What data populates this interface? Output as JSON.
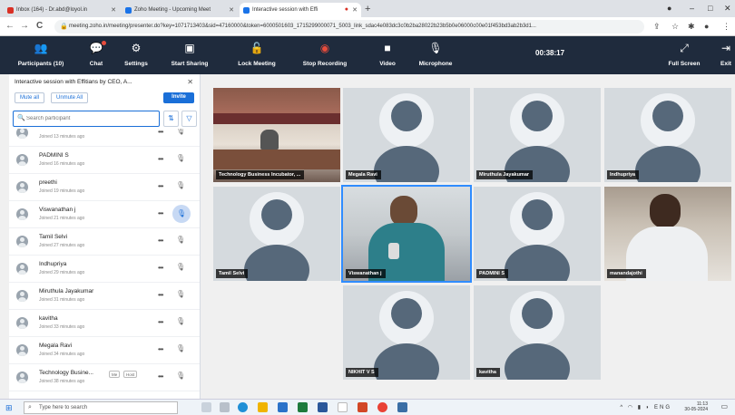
{
  "browser": {
    "tabs": [
      {
        "label": "Inbox (164) - Dr.abd@loyol.in",
        "color": "#d93025"
      },
      {
        "label": "Zoho Meeting - Upcoming Meet",
        "color": "#1a73e8"
      },
      {
        "label": "Interactive session with Effi",
        "color": "#1a73e8"
      }
    ],
    "new_tab": "+",
    "url": "meeting.zoho.in/meeting/presenter.do?key=1071713403&sid=47160000&token=6000501603_1715299000071_5003_link_sdac4e083dc3c0b2ba28022b23b5b0e06000c00e01f453bd3ab2b3d1...",
    "controls": {
      "back": "←",
      "forward": "→",
      "reload": "C"
    }
  },
  "toolbar": {
    "participants": {
      "icon": "participants-icon",
      "label": "Participants (10)"
    },
    "chat": {
      "icon": "chat-icon",
      "label": "Chat"
    },
    "settings": {
      "icon": "gear-icon",
      "label": "Settings"
    },
    "start_sharing": {
      "icon": "screen-share-icon",
      "label": "Start Sharing"
    },
    "lock_meeting": {
      "icon": "lock-icon",
      "label": "Lock Meeting"
    },
    "stop_recording": {
      "icon": "record-icon",
      "label": "Stop Recording"
    },
    "video": {
      "icon": "video-icon",
      "label": "Video"
    },
    "microphone": {
      "icon": "microphone-icon",
      "label": "Microphone"
    },
    "timer": "00:38:17",
    "full_screen": {
      "icon": "fullscreen-icon",
      "label": "Full Screen"
    },
    "exit": {
      "icon": "exit-icon",
      "label": "Exit"
    },
    "accent": "#1f2b3d"
  },
  "panel": {
    "title": "Interactive session with Effitians by CEO, A...",
    "close": "✕",
    "mute_all": "Mute all",
    "unmute_all": "Unmute All",
    "invite": "Invite",
    "search_placeholder": "Search participant",
    "participants": [
      {
        "name": "",
        "joined": "Joined 13 minutes ago"
      },
      {
        "name": "PADMINI S",
        "joined": "Joined 16 minutes ago"
      },
      {
        "name": "preethi",
        "joined": "Joined 19 minutes ago"
      },
      {
        "name": "Viswanathan j",
        "joined": "Joined 21 minutes ago"
      },
      {
        "name": "Tamil Selvi",
        "joined": "Joined 27 minutes ago"
      },
      {
        "name": "Indhupriya",
        "joined": "Joined 29 minutes ago"
      },
      {
        "name": "Miruthula Jayakumar",
        "joined": "Joined 31 minutes ago"
      },
      {
        "name": "kavitha",
        "joined": "Joined 33 minutes ago"
      },
      {
        "name": "Megala Ravi",
        "joined": "Joined 34 minutes ago"
      },
      {
        "name": "Technology Busine...",
        "joined": "Joined 38 minutes ago",
        "tags": [
          "Me",
          "Host"
        ]
      }
    ]
  },
  "tiles": [
    {
      "name": "Technology Business Incubator, ..."
    },
    {
      "name": "Megala Ravi"
    },
    {
      "name": "Miruthula Jayakumar"
    },
    {
      "name": "Indhupriya"
    },
    {
      "name": "Tamil Selvi"
    },
    {
      "name": "Viswanathan j"
    },
    {
      "name": "PADMINI S"
    },
    {
      "name": "manandajothi"
    },
    {
      "name": "NIKHIT V S"
    },
    {
      "name": "kavitha"
    }
  ],
  "taskbar": {
    "search_placeholder": "Type here to search",
    "clock_time": "11:13",
    "clock_date": "30-05-2024",
    "tray": "ENG"
  }
}
